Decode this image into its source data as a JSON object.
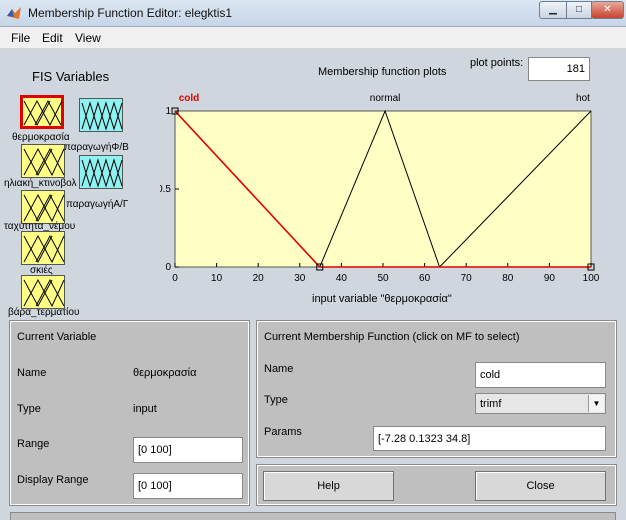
{
  "window": {
    "title": "Membership Function Editor: elegktis1",
    "minimize_glyph": "▁",
    "maximize_glyph": "□",
    "close_glyph": "✕"
  },
  "menu": [
    "File",
    "Edit",
    "View"
  ],
  "fis_variables": {
    "heading": "FIS Variables",
    "inputs": [
      {
        "label": "θερμοκρασία",
        "selected": true
      },
      {
        "label": "ηλιακή_κτινοβολ"
      },
      {
        "label": "ταχύτητα_νέμου"
      },
      {
        "label": "σκιές"
      },
      {
        "label": "βάρα_τερματίου"
      }
    ],
    "outputs": [
      {
        "label": "παραγωγήΦ/Β"
      },
      {
        "label": "παραγωγήΑ/Γ"
      }
    ]
  },
  "plot": {
    "title": "Membership function plots",
    "plot_points_label": "plot points:",
    "plot_points_value": "181"
  },
  "chart_data": {
    "type": "line",
    "title": "Membership function plots",
    "xlabel": "input variable \"θερμοκρασία\"",
    "ylabel": "",
    "xlim": [
      0,
      100
    ],
    "ylim": [
      0,
      1
    ],
    "xticks": [
      "0",
      "10",
      "20",
      "30",
      "40",
      "50",
      "60",
      "70",
      "80",
      "90",
      "100"
    ],
    "yticks": [
      "0",
      "0.5",
      "1"
    ],
    "series": [
      {
        "name": "cold",
        "x": [
          0,
          34.8,
          100
        ],
        "y": [
          1,
          0,
          0
        ],
        "color": "#e00000",
        "selected": true
      },
      {
        "name": "normal",
        "x": [
          34.8,
          50.5,
          63.6
        ],
        "y": [
          0,
          1,
          0
        ],
        "color": "#000000"
      },
      {
        "name": "hot",
        "x": [
          63.6,
          100
        ],
        "y": [
          0,
          1
        ],
        "color": "#000000"
      }
    ],
    "background": "#ffffc5"
  },
  "current_variable": {
    "heading": "Current Variable",
    "name_label": "Name",
    "name_value": "θερμοκρασία",
    "type_label": "Type",
    "type_value": "input",
    "range_label": "Range",
    "range_value": "[0 100]",
    "display_range_label": "Display Range",
    "display_range_value": "[0 100]"
  },
  "current_mf": {
    "heading": "Current Membership Function (click on MF to select)",
    "name_label": "Name",
    "name_value": "cold",
    "type_label": "Type",
    "type_value": "trimf",
    "params_label": "Params",
    "params_value": "[-7.28 0.1323 34.8]"
  },
  "buttons": {
    "help": "Help",
    "close": "Close"
  },
  "colors": {
    "input_var": "#ffff85",
    "output_var": "#8ef2f2",
    "selected": "#e00000"
  }
}
